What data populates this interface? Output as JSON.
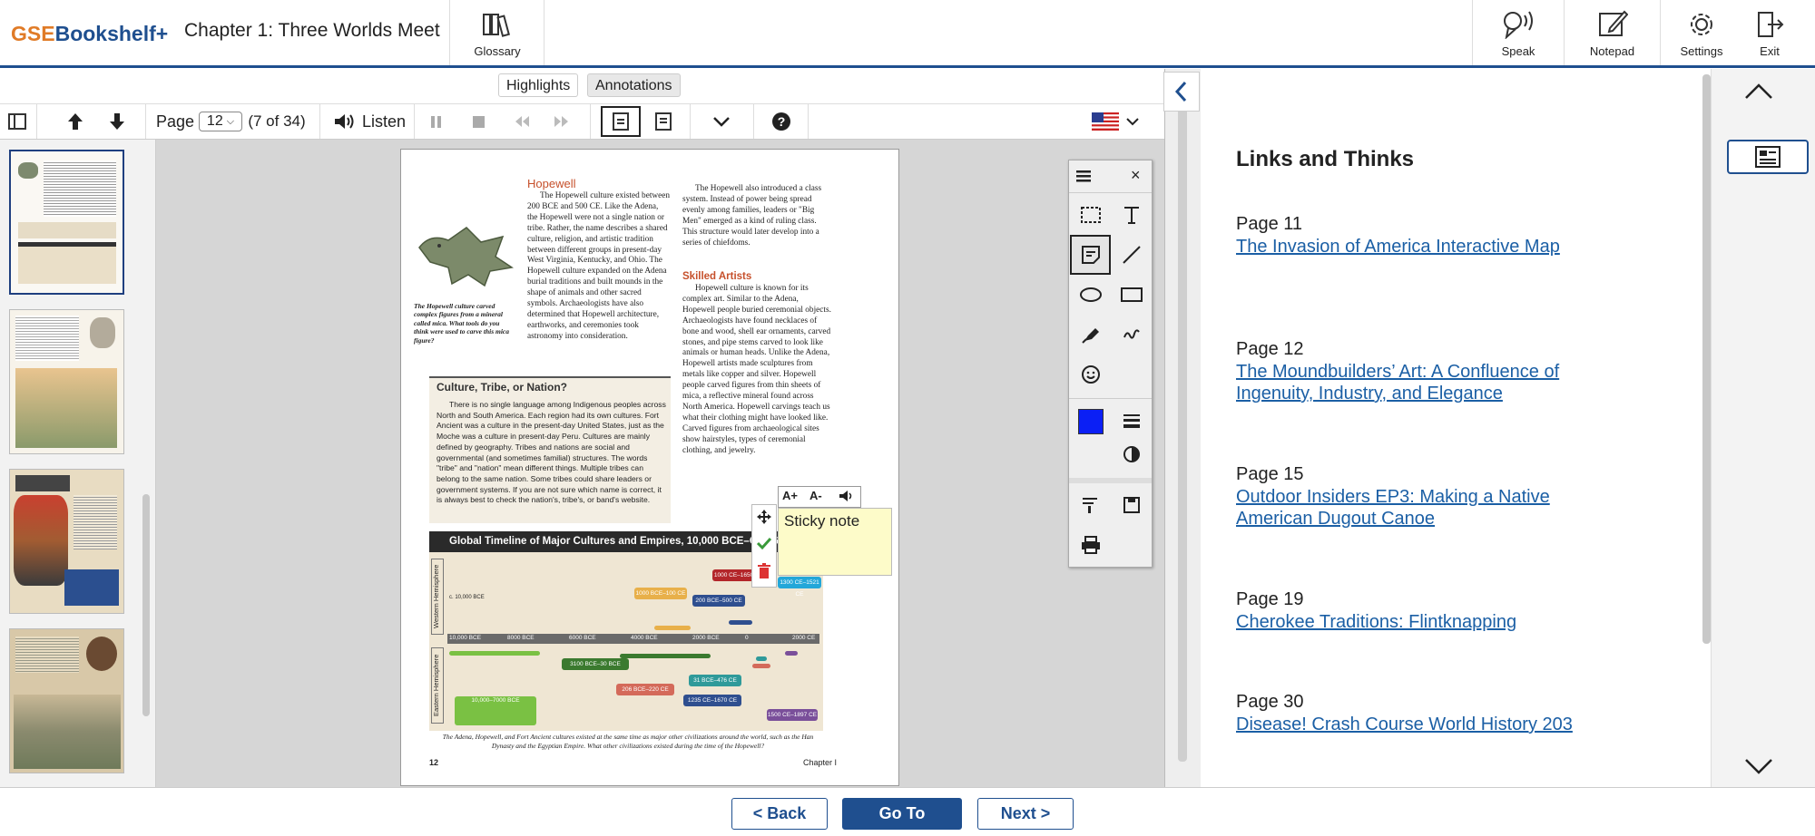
{
  "header": {
    "logo_gse": "GSE",
    "logo_rest": "Bookshelf+",
    "chapter_title": "Chapter 1: Three Worlds Meet",
    "glossary_label": "Glossary",
    "speak_label": "Speak",
    "notepad_label": "Notepad",
    "settings_label": "Settings",
    "exit_label": "Exit"
  },
  "view_tabs": {
    "highlights": "Highlights",
    "annotations": "Annotations"
  },
  "toolbar": {
    "page_label": "Page",
    "page_value": "12",
    "page_count": "(7 of 34)",
    "listen_label": "Listen"
  },
  "page": {
    "hopewell_heading": "Hopewell",
    "hopewell_text": "The Hopewell culture existed between 200 BCE and 500 CE. Like the Adena, the Hopewell were not a single nation or tribe. Rather, the name describes a shared culture, religion, and artistic tradition between different groups in present-day West Virginia, Kentucky, and Ohio. The Hopewell culture expanded on the Adena burial traditions and built mounds in the shape of animals and other sacred symbols. Archaeologists have also determined that Hopewell architecture, earthworks, and ceremonies took astronomy into consideration.",
    "bird_caption": "The Hopewell culture carved complex figures from a mineral called mica. What tools do you think were used to carve this mica figure?",
    "class_text": "The Hopewell also introduced a class system. Instead of power being spread evenly among families, leaders or \"Big Men\" emerged as a kind of ruling class. This structure would later develop into a series of chiefdoms.",
    "skilled_heading": "Skilled Artists",
    "skilled_text": "Hopewell culture is known for its complex art. Similar to the Adena, Hopewell people buried ceremonial objects. Archaeologists have found necklaces of bone and wood, shell ear ornaments, carved stones, and pipe stems carved to look like animals or human heads. Unlike the Adena, Hopewell artists made sculptures from metals like copper and silver. Hopewell people carved figures from thin sheets of mica, a reflective mineral found across North America. Hopewell carvings teach us what their clothing might have looked like. Carved figures from archaeological sites show hairstyles, types of ceremonial clothing, and jewelry.",
    "box_heading": "Culture, Tribe, or Nation?",
    "box_text": "There is no single language among Indigenous peoples across North and South America. Each region had its own cultures. Fort Ancient was a culture in the present-day United States, just as the Moche was a culture in present-day Peru. Cultures are mainly defined by geography. Tribes and nations are social and governmental (and sometimes familial) structures. The words \"tribe\" and \"nation\" mean different things. Multiple tribes can belong to the same nation. Some tribes could share leaders or government systems. If you are not sure which name is correct, it is always best to check the nation's, tribe's, or band's website.",
    "timeline_title": "Global Timeline of Major Cultures and Empires, 10,000 BCE–CE 1600",
    "western_label": "Western Hemisphere",
    "eastern_label": "Eastern Hemisphere",
    "axis_ticks": [
      "10,000 BCE",
      "8000 BCE",
      "6000 BCE",
      "4000 BCE",
      "2000 BCE",
      "0",
      "2000 CE"
    ],
    "tl_items": [
      "c. 10,000 BCE",
      "1000 BCE–100 CE",
      "200 BCE–500 CE",
      "1000 CE–1650 CE",
      "1300 CE–1521 CE",
      "3100 BCE–30 BCE",
      "31 BCE–476 CE",
      "206 BCE–220 CE",
      "1235 CE–1670 CE",
      "10,000–7000 BCE",
      "1500 CE–1897 CE"
    ],
    "timeline_caption": "The Adena, Hopewell, and Fort Ancient cultures existed at the same time as major other civilizations around the world, such as the Han Dynasty and the Egyptian Empire. What other civilizations existed during the time of the Hopewell?",
    "page_number": "12",
    "chapter_footer": "Chapter I"
  },
  "sticky": {
    "text": "Sticky note",
    "font_up": "A+",
    "font_down": "A-"
  },
  "colors": {
    "brand_blue": "#1f4f8f",
    "brand_orange": "#e07b27",
    "link": "#1b5fa5",
    "annotation_color": "#0b1ff5"
  },
  "links_panel": {
    "title": "Links and Thinks",
    "items": [
      {
        "page": "Page 11",
        "link": "The Invasion of America Interactive Map"
      },
      {
        "page": "Page 12",
        "link": "The Moundbuilders’ Art: A Confluence of Ingenuity, Industry, and Elegance"
      },
      {
        "page": "Page 15",
        "link": "Outdoor Insiders EP3: Making a Native American Dugout Canoe"
      },
      {
        "page": "Page 19",
        "link": "Cherokee Traditions: Flintknapping"
      },
      {
        "page": "Page 30",
        "link": "Disease! Crash Course World History 203"
      }
    ]
  },
  "footer": {
    "back": "< Back",
    "goto": "Go To",
    "next": "Next >"
  }
}
